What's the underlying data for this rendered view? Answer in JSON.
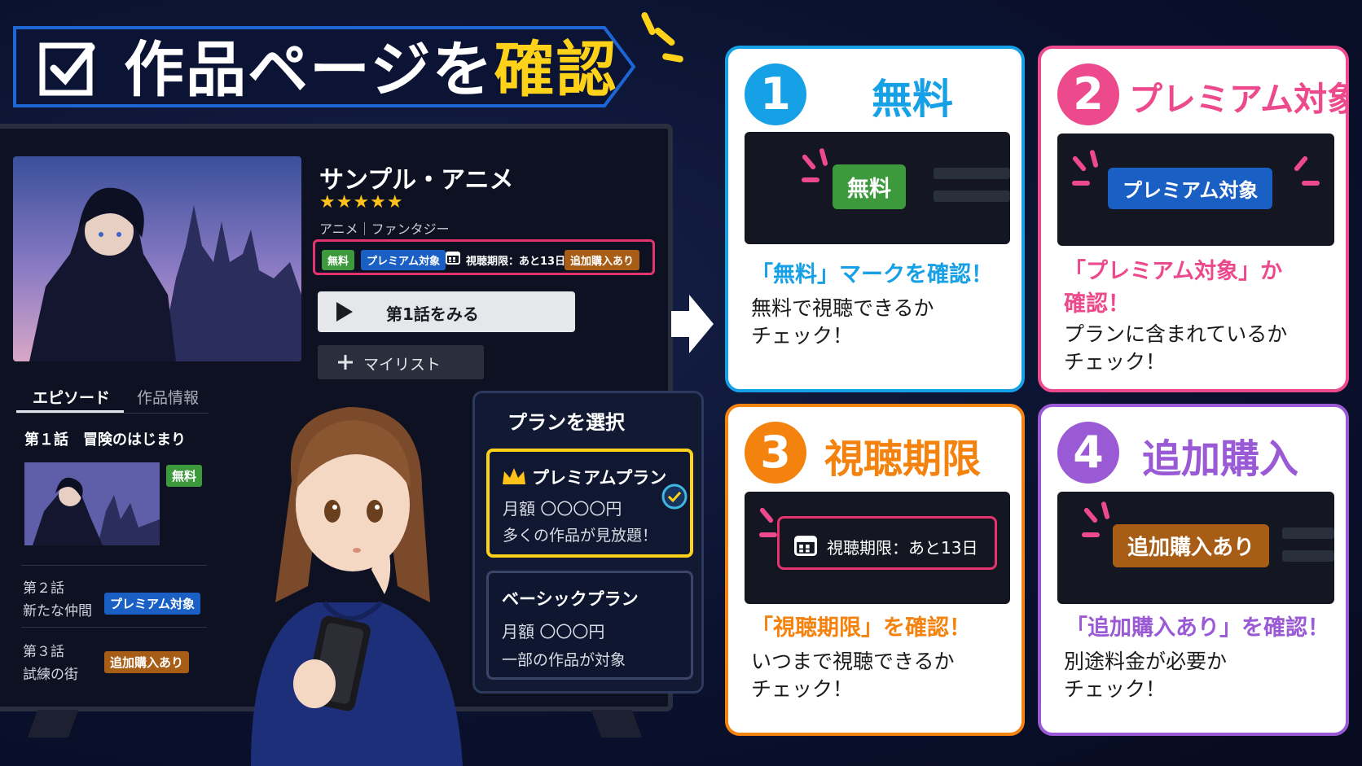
{
  "banner": {
    "title_main": "作品ページを",
    "title_highlight": "確認"
  },
  "colors": {
    "accent_yellow": "#ffd21a",
    "free_green": "#3c9a3d",
    "premium_blue": "#1a5fc4",
    "purchase_orange": "#a85d16",
    "card1": "#16a0e6",
    "card2": "#ec4a8c",
    "card3": "#f4820e",
    "card4": "#9a5ad6"
  },
  "tv": {
    "anime_title": "サンプル・アニメ",
    "stars": "★★★★★",
    "genre": "アニメ｜ファンタジー",
    "badges": {
      "free": "無料",
      "premium": "プレミアム対象",
      "deadline": "視聴期限：あと13日",
      "purchase": "追加購入あり"
    },
    "play_button": "第1話をみる",
    "mylist_button": "マイリスト",
    "tabs": {
      "episodes": "エピソード",
      "info": "作品情報"
    },
    "episodes": [
      {
        "number": "第１話",
        "title": "冒険のはじまり",
        "badge": "無料"
      },
      {
        "number": "第２話",
        "title": "新たな仲間",
        "badge": "プレミアム対象"
      },
      {
        "number": "第３話",
        "title": "試練の街",
        "badge": "追加購入あり"
      }
    ]
  },
  "plans": {
    "title": "プランを選択",
    "premium": {
      "name": "プレミアムプラン",
      "price": "月額 〇〇〇〇円",
      "desc": "多くの作品が見放題！"
    },
    "basic": {
      "name": "ベーシックプラン",
      "price": "月額 〇〇〇円",
      "desc": "一部の作品が対象"
    }
  },
  "cards": [
    {
      "num": "1",
      "heading": "無料",
      "badge": "無料",
      "check": "「無料」マークを確認！",
      "body": [
        "無料で視聴できるか",
        "チェック！"
      ]
    },
    {
      "num": "2",
      "heading": "プレミアム対象",
      "badge": "プレミアム対象",
      "check": [
        "「プレミアム対象」か",
        "確認！"
      ],
      "body": [
        "プランに含まれているか",
        "チェック！"
      ]
    },
    {
      "num": "3",
      "heading": "視聴期限",
      "badge": "視聴期限：あと13日",
      "check": "「視聴期限」を確認！",
      "body": [
        "いつまで視聴できるか",
        "チェック！"
      ]
    },
    {
      "num": "4",
      "heading": "追加購入",
      "badge": "追加購入あり",
      "check": "「追加購入あり」を確認！",
      "body": [
        "別途料金が必要か",
        "チェック！"
      ]
    }
  ]
}
